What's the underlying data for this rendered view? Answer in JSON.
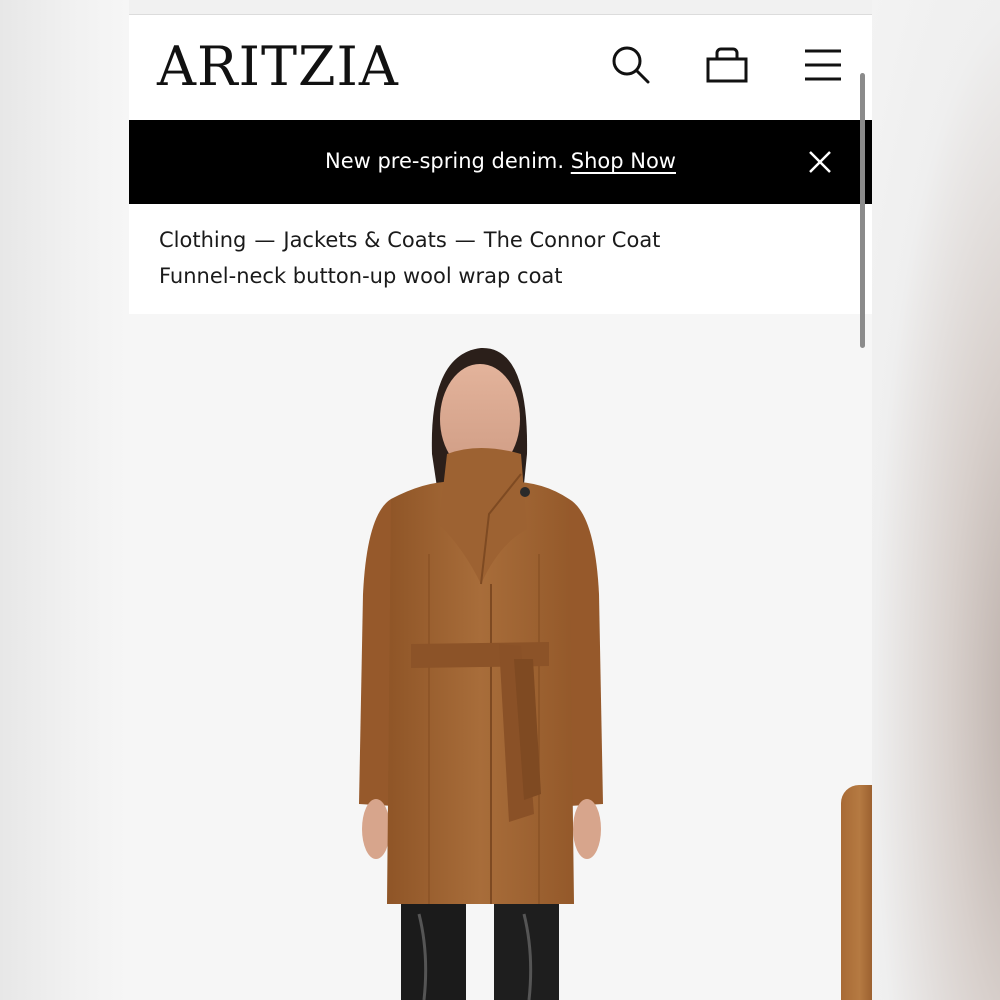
{
  "header": {
    "logo": "ARITZIA",
    "icons": [
      "search-icon",
      "shopping-bag-icon",
      "menu-icon"
    ]
  },
  "banner": {
    "text": "New pre-spring denim.",
    "link": "Shop Now",
    "close_icon": "close-icon"
  },
  "breadcrumb": {
    "items": [
      "Clothing",
      "Jackets & Coats",
      "The Connor Coat"
    ],
    "separator": "—"
  },
  "product": {
    "description": "Funnel-neck button-up wool wrap coat",
    "coat_color": "#a86d3a"
  },
  "colors": {
    "banner_bg": "#000000",
    "text": "#1a1a1a"
  }
}
